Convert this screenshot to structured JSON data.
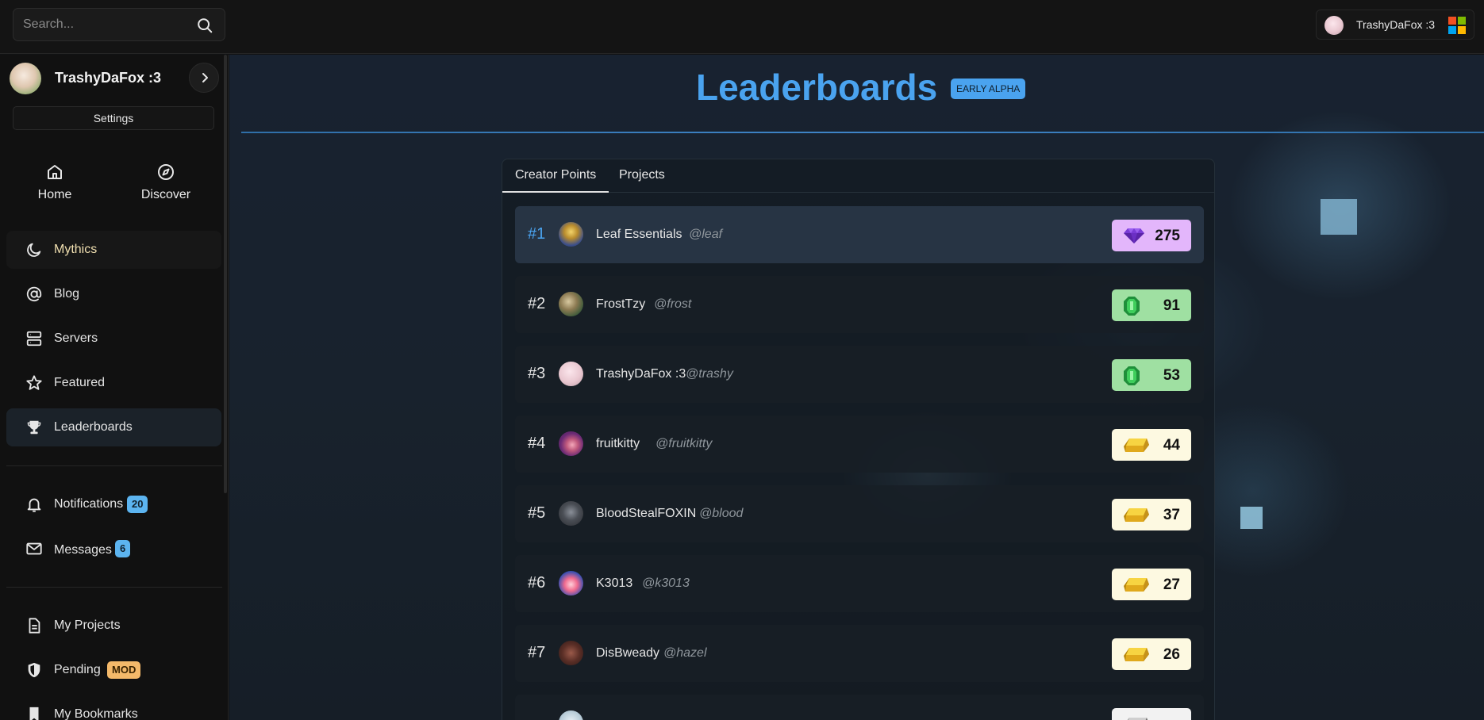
{
  "search": {
    "placeholder": "Search..."
  },
  "account": {
    "name": "TrashyDaFox :3"
  },
  "colors": {
    "accent": "#4aa3ef",
    "diamond": "#e3b6fb",
    "emerald": "#9fe0a2",
    "gold": "#fdf9e1"
  },
  "sidebar": {
    "profile_name": "TrashyDaFox :3",
    "settings_label": "Settings",
    "quick": [
      {
        "label": "Home",
        "icon": "home-icon"
      },
      {
        "label": "Discover",
        "icon": "compass-icon"
      }
    ],
    "items": [
      {
        "label": "Mythics",
        "icon": "moon-icon"
      },
      {
        "label": "Blog",
        "icon": "at-icon"
      },
      {
        "label": "Servers",
        "icon": "server-icon"
      },
      {
        "label": "Featured",
        "icon": "star-icon"
      },
      {
        "label": "Leaderboards",
        "icon": "trophy-icon"
      }
    ],
    "notifications": {
      "label": "Notifications",
      "count": "20"
    },
    "messages": {
      "label": "Messages",
      "count": "6"
    },
    "my_projects": "My Projects",
    "pending": {
      "label": "Pending",
      "badge": "MOD"
    },
    "bookmarks": "My Bookmarks"
  },
  "main": {
    "title": "Leaderboards",
    "badge": "EARLY ALPHA",
    "tabs": [
      "Creator Points",
      "Projects"
    ],
    "rows": [
      {
        "rank": "#1",
        "name": "Leaf Essentials",
        "handle": "@leaf",
        "points": "275",
        "tier": "diamond"
      },
      {
        "rank": "#2",
        "name": "FrostTzy",
        "handle": "@frost",
        "points": "91",
        "tier": "emerald"
      },
      {
        "rank": "#3",
        "name": "TrashyDaFox :3",
        "handle": "@trashy",
        "points": "53",
        "tier": "emerald"
      },
      {
        "rank": "#4",
        "name": "fruitkitty",
        "handle": "@fruitkitty",
        "points": "44",
        "tier": "gold"
      },
      {
        "rank": "#5",
        "name": "BloodStealFOXIN",
        "handle": "@blood",
        "points": "37",
        "tier": "gold"
      },
      {
        "rank": "#6",
        "name": "K3013",
        "handle": "@k3013",
        "points": "27",
        "tier": "gold"
      },
      {
        "rank": "#7",
        "name": "DisBweady",
        "handle": "@hazel",
        "points": "26",
        "tier": "gold"
      }
    ]
  }
}
